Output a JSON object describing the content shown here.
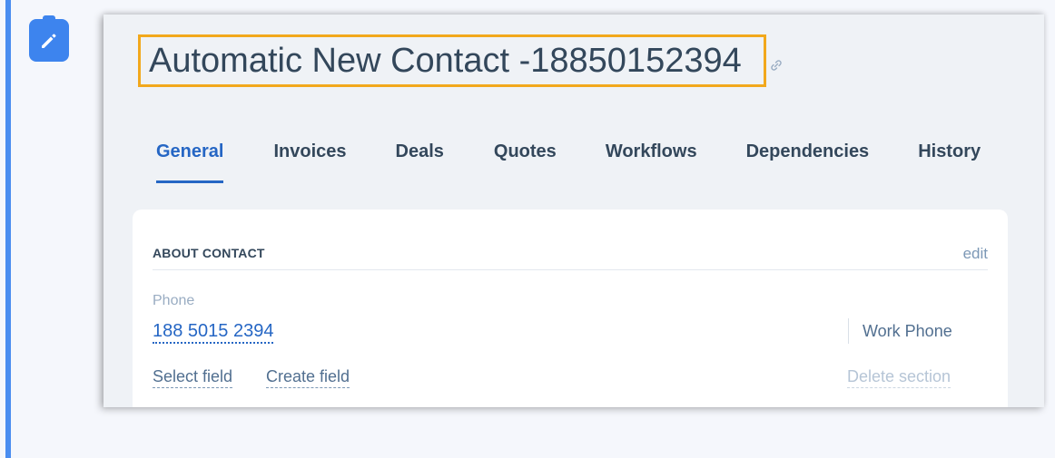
{
  "record": {
    "title": "Automatic New Contact -18850152394"
  },
  "tabs": [
    {
      "label": "General",
      "active": true
    },
    {
      "label": "Invoices",
      "active": false
    },
    {
      "label": "Deals",
      "active": false
    },
    {
      "label": "Quotes",
      "active": false
    },
    {
      "label": "Workflows",
      "active": false
    },
    {
      "label": "Dependencies",
      "active": false
    },
    {
      "label": "History",
      "active": false
    }
  ],
  "about_card": {
    "title": "ABOUT CONTACT",
    "edit_label": "edit",
    "field": {
      "label": "Phone",
      "value": "188 5015 2394",
      "type_label": "Work Phone"
    },
    "actions": {
      "select_field": "Select field",
      "create_field": "Create field",
      "delete_section": "Delete section"
    }
  },
  "colors": {
    "accent": "#2566c4",
    "highlight_border": "#f2a81c",
    "badge": "#3d84ee",
    "left_bar": "#4a8df0"
  },
  "icons": {
    "badge": "pencil-icon",
    "title_link": "link-icon"
  }
}
